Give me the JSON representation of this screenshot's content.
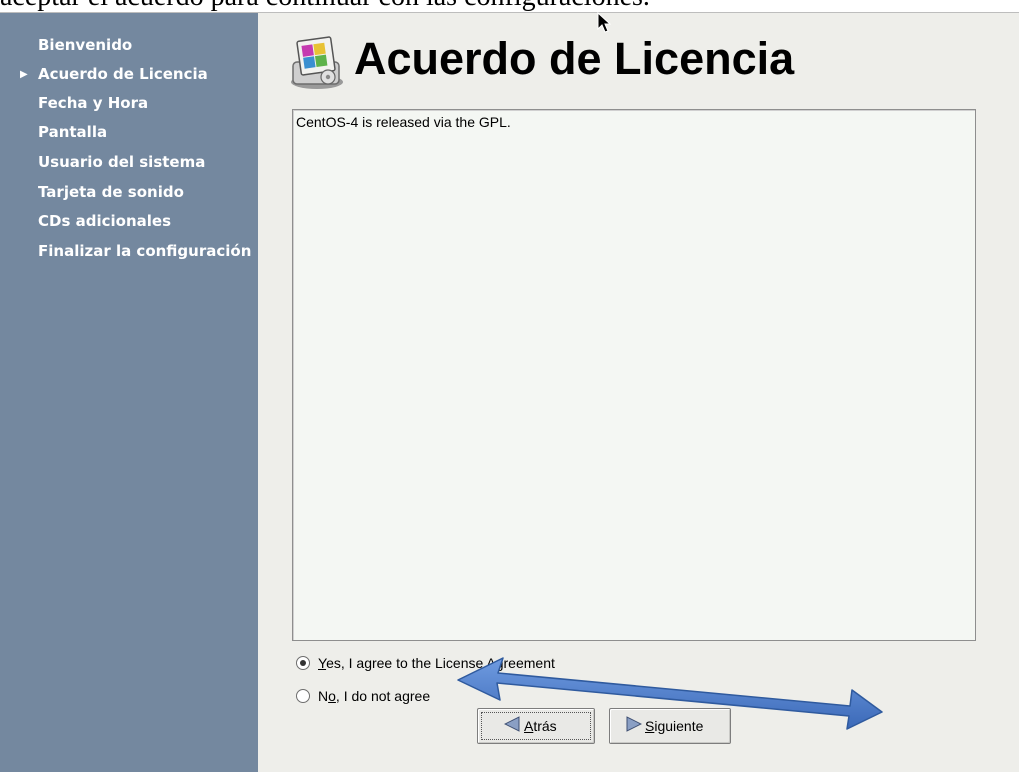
{
  "document": {
    "caption": "aceptar el acuerdo para continuar con las configuraciones."
  },
  "sidebar": {
    "items": [
      {
        "label": "Bienvenido"
      },
      {
        "label": "Acuerdo de Licencia",
        "active": true
      },
      {
        "label": "Fecha y Hora"
      },
      {
        "label": "Pantalla"
      },
      {
        "label": "Usuario del sistema"
      },
      {
        "label": "Tarjeta de sonido"
      },
      {
        "label": "CDs adicionales"
      },
      {
        "label": "Finalizar la configuración"
      }
    ],
    "active_marker_icon": "triangle-right-icon"
  },
  "main": {
    "title": "Acuerdo de Licencia",
    "title_icon": "license-app-icon",
    "license_text": "CentOS-4 is released via the GPL.",
    "options": {
      "agree": {
        "mnemonic": "Y",
        "label_rest": "es, I agree to the License Agreement",
        "selected": true
      },
      "disagree": {
        "label_prefix": "N",
        "mnemonic": "o",
        "label_rest": ", I do not agree",
        "selected": false
      }
    },
    "buttons": {
      "back": {
        "mnemonic": "A",
        "label_rest": "trás",
        "icon": "arrow-left-icon"
      },
      "next": {
        "mnemonic": "S",
        "label_rest": "iguiente",
        "icon": "arrow-right-icon"
      }
    }
  },
  "overlay": {
    "cursor_icon": "mouse-pointer-icon",
    "annotation_icon": "double-headed-arrow-icon",
    "annotation_color": "#4a7bd0"
  },
  "colors": {
    "sidebar_bg": "#74889f",
    "main_bg": "#eeeeea",
    "license_box_bg": "#f4f7f3"
  }
}
